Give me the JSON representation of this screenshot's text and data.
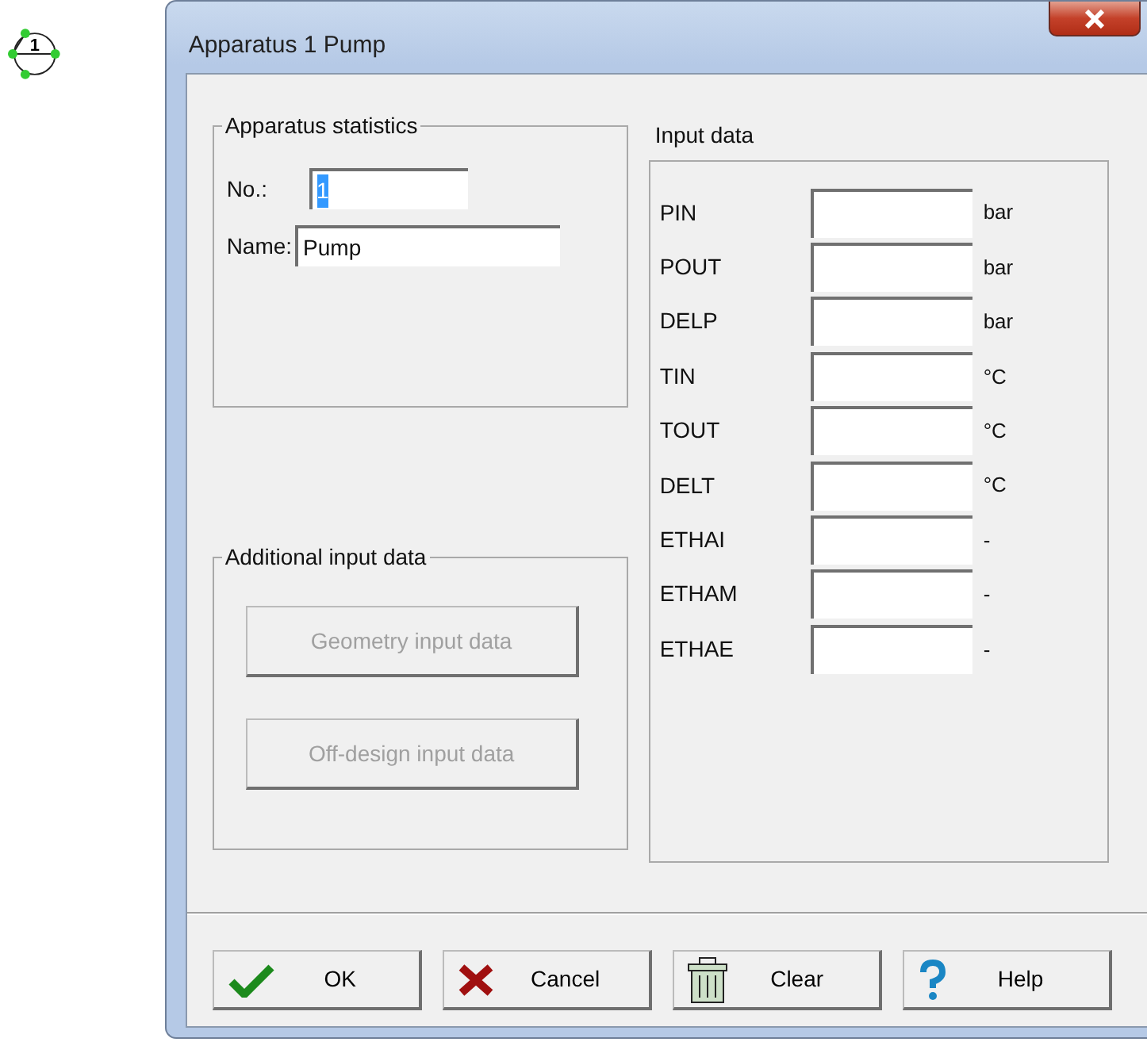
{
  "canvas_node": {
    "label": "1"
  },
  "window": {
    "title": "Apparatus 1  Pump"
  },
  "apparatus_statistics": {
    "title": "Apparatus statistics",
    "fields": [
      {
        "label": "No.:",
        "value": "1",
        "highlighted": true
      },
      {
        "label": "Name:",
        "value": "Pump",
        "highlighted": false
      }
    ]
  },
  "additional_input_data": {
    "title": "Additional input data",
    "buttons": [
      {
        "label": "Geometry input data",
        "disabled": true
      },
      {
        "label": "Off-design input data",
        "disabled": true
      }
    ]
  },
  "input_data": {
    "title": "Input data",
    "rows": [
      {
        "label": "PIN",
        "unit": "bar"
      },
      {
        "label": "POUT",
        "unit": "bar"
      },
      {
        "label": "DELP",
        "unit": "bar"
      },
      {
        "label": "TIN",
        "unit": "°C"
      },
      {
        "label": "TOUT",
        "unit": "°C"
      },
      {
        "label": "DELT",
        "unit": "°C"
      },
      {
        "label": "ETHAI",
        "unit": "-"
      },
      {
        "label": "ETHAM",
        "unit": "-"
      },
      {
        "label": "ETHAE",
        "unit": "-"
      }
    ]
  },
  "buttons": [
    {
      "label": "OK",
      "kind": "ok"
    },
    {
      "label": "Cancel",
      "kind": "cancel"
    },
    {
      "label": "Clear",
      "kind": "clear"
    },
    {
      "label": "Help",
      "kind": "help"
    }
  ]
}
